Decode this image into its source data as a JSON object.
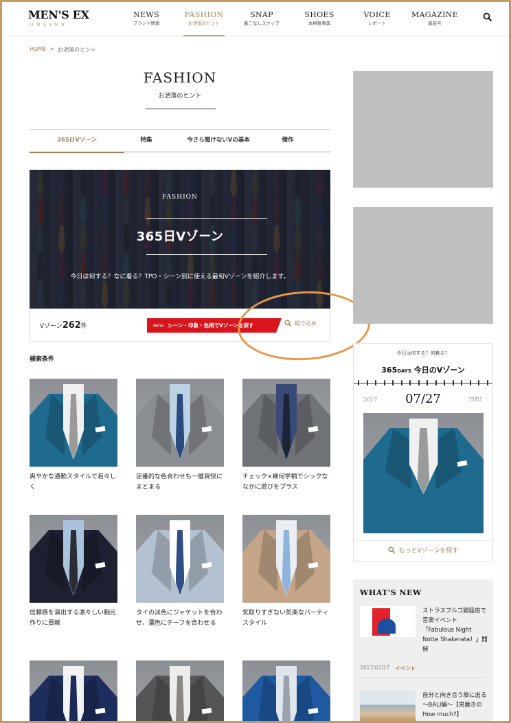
{
  "header": {
    "logo": {
      "main": "MEN'S EX",
      "sub": "ONLINE"
    },
    "nav": [
      {
        "en": "NEWS",
        "jp": "ブランド情報",
        "active": false
      },
      {
        "en": "FASHION",
        "jp": "お洒落のヒント",
        "active": true
      },
      {
        "en": "SNAP",
        "jp": "着こなしスナップ",
        "active": false
      },
      {
        "en": "SHOES",
        "jp": "本格靴事典",
        "active": false
      },
      {
        "en": "VOICE",
        "jp": "レポート",
        "active": false
      },
      {
        "en": "MAGAZINE",
        "jp": "最新号",
        "active": false
      }
    ],
    "search_icon": "search-icon"
  },
  "breadcrumb": {
    "home": "HOME",
    "sep": ">",
    "current": "お洒落のヒント"
  },
  "page": {
    "title": "FASHION",
    "subtitle": "お洒落のヒント"
  },
  "subtabs": [
    {
      "label": "365日Vゾーン",
      "active": true
    },
    {
      "label": "特集",
      "active": false
    },
    {
      "label": "今さら聞けないVの基本",
      "active": false
    },
    {
      "label": "傑作",
      "active": false
    }
  ],
  "hero": {
    "kicker": "FASHION",
    "title": "365日Vゾーン",
    "desc": "今日は何する？なに着る？TPO・シーン別に使える最旬Vゾーンを紹介します。"
  },
  "countbar": {
    "prefix": "Vゾーン",
    "count": "262",
    "suffix": "件",
    "find_new": "NEW",
    "find_label": "シーン・印象・色柄でVゾーンを探す",
    "filter_label": "絞り込み"
  },
  "search_condition": "検索条件",
  "cards": [
    {
      "text": "爽やかな通勤スタイルで若々しく",
      "jacket": "#1f6b8f",
      "shirt": "#f0f0f0",
      "tie": "#9a9a9a"
    },
    {
      "text": "定番的な色合わせも一層爽快にまとまる",
      "jacket": "#8a8d92",
      "shirt": "#bcd3e6",
      "tie": "#2a4a80"
    },
    {
      "text": "チェック×幾何学柄でシックななかに遊びをプラス",
      "jacket": "#6f7276",
      "shirt": "#3a4a78",
      "tie": "#1c2438"
    },
    {
      "text": "信頼感を演出する凛々しい胸元作りに貢献",
      "jacket": "#1c2030",
      "shirt": "#a9c3dd",
      "tie": "#2a2d36"
    },
    {
      "text": "タイの淡色にジャケットを合わせ、濃色にチーフを合わせる",
      "jacket": "#b2c0cf",
      "shirt": "#ffffff",
      "tie": "#2f4f86"
    },
    {
      "text": "気取りすぎない気楽なパーティスタイル",
      "jacket": "#c4a588",
      "shirt": "#e8eef4",
      "tie": "#8fb4dc"
    },
    {
      "text": "",
      "jacket": "#1d2e5c",
      "shirt": "#f2f2f2",
      "tie": "#1b2a57"
    },
    {
      "text": "",
      "jacket": "#555558",
      "shirt": "#ececec",
      "tie": "#8b8780"
    },
    {
      "text": "",
      "jacket": "#1f5aa1",
      "shirt": "#dfe6ee",
      "tie": "#9aa2ab"
    }
  ],
  "vzone": {
    "kicker": "今日は何する？何着る？",
    "title_num": "365",
    "title_days": "DAYS",
    "title_rest": "今日のVゾーン",
    "year": "2017",
    "date": "07/27",
    "day": "THU.",
    "link": "もっとVゾーンを探す",
    "jacket": "#1f6b8f",
    "shirt": "#f0f0f0",
    "tie": "#9a9a9a"
  },
  "whats_new": {
    "title": "WHAT'S NEW",
    "items": [
      {
        "text": "ストラスブルゴ銀座店で音楽イベント「Fabulous Night Notte Shakerata！」開催",
        "date": "2017/07/27",
        "category": "イベント"
      },
      {
        "text": "自分と向き合う旅に出る～BALI編～【男磨きのHow much?】"
      }
    ]
  },
  "colors": {
    "accent": "#a8845a",
    "frame": "#c49a63",
    "red": "#d8141d",
    "annotation": "#e8964a"
  }
}
